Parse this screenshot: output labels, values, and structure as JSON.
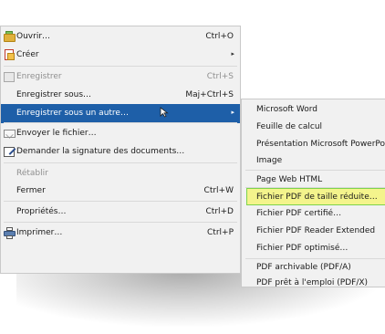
{
  "main_menu": {
    "items": [
      {
        "name": "open",
        "label": "Ouvrir…",
        "shortcut": "Ctrl+O",
        "icon": "folder-open-icon",
        "enabled": true
      },
      {
        "name": "create",
        "label": "Créer",
        "icon": "create-document-icon",
        "has_submenu": true,
        "enabled": true
      },
      {
        "name": "save",
        "label": "Enregistrer",
        "shortcut": "Ctrl+S",
        "icon": "save-icon",
        "enabled": false
      },
      {
        "name": "save-as",
        "label": "Enregistrer sous…",
        "shortcut": "Maj+Ctrl+S",
        "enabled": true
      },
      {
        "name": "save-as-other",
        "label": "Enregistrer sous un autre…",
        "has_submenu": true,
        "selected": true,
        "enabled": true
      },
      {
        "name": "send-file",
        "label": "Envoyer le fichier…",
        "icon": "envelope-icon",
        "enabled": true
      },
      {
        "name": "request-signature",
        "label": "Demander la signature des documents…",
        "icon": "signature-icon",
        "enabled": true
      },
      {
        "name": "restore",
        "label": "Rétablir",
        "enabled": false
      },
      {
        "name": "close",
        "label": "Fermer",
        "shortcut": "Ctrl+W",
        "enabled": true
      },
      {
        "name": "properties",
        "label": "Propriétés…",
        "shortcut": "Ctrl+D",
        "enabled": true
      },
      {
        "name": "print",
        "label": "Imprimer…",
        "shortcut": "Ctrl+P",
        "icon": "printer-icon",
        "enabled": true
      }
    ]
  },
  "submenu": {
    "items": [
      {
        "name": "microsoft-word",
        "label": "Microsoft Word"
      },
      {
        "name": "spreadsheet",
        "label": "Feuille de calcul"
      },
      {
        "name": "powerpoint",
        "label": "Présentation Microsoft PowerPoint"
      },
      {
        "name": "image",
        "label": "Image"
      },
      {
        "name": "html",
        "label": "Page Web HTML"
      },
      {
        "name": "reduced-pdf",
        "label": "Fichier PDF de taille réduite…",
        "highlighted": true
      },
      {
        "name": "certified-pdf",
        "label": "Fichier PDF certifié…"
      },
      {
        "name": "reader-extended-pdf",
        "label": "Fichier PDF Reader Extended"
      },
      {
        "name": "optimized-pdf",
        "label": "Fichier PDF optimisé…"
      },
      {
        "name": "pdfa",
        "label": "PDF archivable (PDF/A)"
      },
      {
        "name": "pdfx",
        "label": "PDF prêt à l'emploi (PDF/X)"
      }
    ]
  },
  "colors": {
    "menu_bg": "#f1f1f1",
    "selected_bg": "#1e5fa8",
    "highlight_bg": "#f4f48c",
    "highlight_border": "#7ed34c",
    "disabled_text": "#8f8f8f"
  }
}
